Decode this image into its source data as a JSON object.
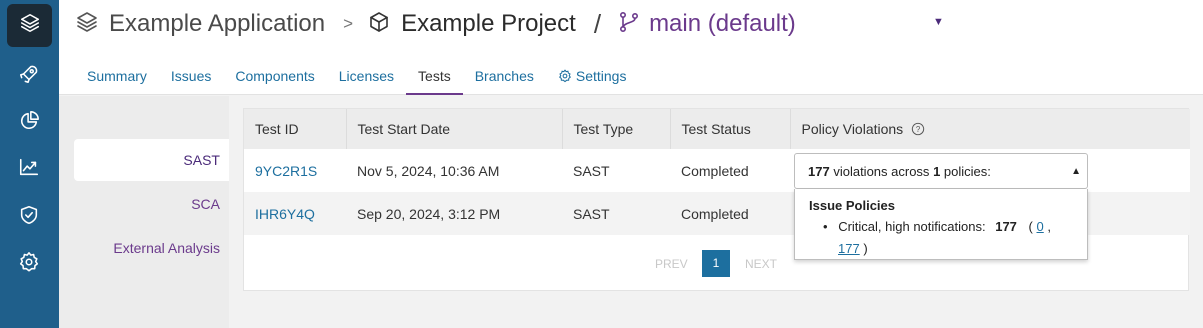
{
  "breadcrumb": {
    "application": "Example Application",
    "separator1": ">",
    "project": "Example Project",
    "separator2": "/",
    "branch": "main (default)"
  },
  "tabs": [
    "Summary",
    "Issues",
    "Components",
    "Licenses",
    "Tests",
    "Branches",
    "Settings"
  ],
  "active_tab": "Tests",
  "sidebar_nav": [
    "home-layers-icon",
    "rocket-icon",
    "pie-chart-icon",
    "trending-chart-icon",
    "shield-check-icon",
    "settings-gear-icon"
  ],
  "subnav": {
    "items": [
      "SAST",
      "SCA",
      "External Analysis"
    ],
    "active": "SAST"
  },
  "table": {
    "columns": [
      "Test ID",
      "Test Start Date",
      "Test Type",
      "Test Status",
      "Policy Violations"
    ],
    "rows": [
      {
        "id": "9YC2R1S",
        "start": "Nov 5, 2024, 10:36 AM",
        "type": "SAST",
        "status": "Completed"
      },
      {
        "id": "IHR6Y4Q",
        "start": "Sep 20, 2024, 3:12 PM",
        "type": "SAST",
        "status": "Completed"
      }
    ]
  },
  "pagination": {
    "prev": "PREV",
    "page": "1",
    "next": "NEXT"
  },
  "violations_dropdown": {
    "count": "177",
    "text_mid": "violations across",
    "policies": "1",
    "text_end": "policies:",
    "group_title": "Issue Policies",
    "item_label": "Critical, high notifications:",
    "item_count": "177",
    "link1": "0",
    "link2": "177",
    "open_paren": "(",
    "comma": ",",
    "close_paren": ")"
  },
  "colors": {
    "rail": "#1f5f8b",
    "accent_purple": "#6b3a8c",
    "link_blue": "#1d6f9f"
  }
}
